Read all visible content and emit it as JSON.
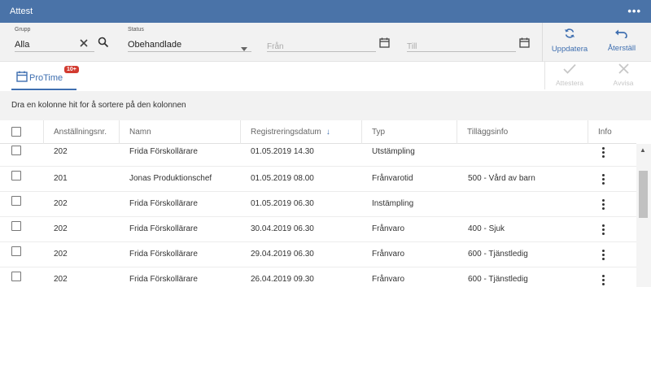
{
  "window": {
    "title": "Attest",
    "more_icon": "more-horizontal-icon"
  },
  "filters": {
    "group": {
      "label": "Grupp",
      "value": "Alla"
    },
    "status": {
      "label": "Status",
      "value": "Obehandlade"
    },
    "from": {
      "placeholder": "Från"
    },
    "to": {
      "placeholder": "Till"
    }
  },
  "actions": {
    "refresh": "Uppdatera",
    "reset": "Återställ",
    "approve": "Attestera",
    "reject": "Avvisa"
  },
  "tabs": [
    {
      "label": "ProTime",
      "badge": "10+"
    }
  ],
  "grid": {
    "group_hint": "Dra en kolonne hit for å sortere på den kolonnen",
    "columns": [
      "Anställningsnr.",
      "Namn",
      "Registreringsdatum",
      "Typ",
      "Tilläggsinfo",
      "Info"
    ],
    "sort_column": "Registreringsdatum",
    "sort_direction": "descending",
    "rows": [
      {
        "emp": "202",
        "name": "Frida Förskollärare",
        "date": "01.05.2019 14.30",
        "type": "Utstämpling",
        "info": ""
      },
      {
        "emp": "201",
        "name": "Jonas Produktionschef",
        "date": "01.05.2019 08.00",
        "type": "Frånvarotid",
        "info": "500 - Vård av barn"
      },
      {
        "emp": "202",
        "name": "Frida Förskollärare",
        "date": "01.05.2019 06.30",
        "type": "Instämpling",
        "info": ""
      },
      {
        "emp": "202",
        "name": "Frida Förskollärare",
        "date": "30.04.2019 06.30",
        "type": "Frånvaro",
        "info": "400 - Sjuk"
      },
      {
        "emp": "202",
        "name": "Frida Förskollärare",
        "date": "29.04.2019 06.30",
        "type": "Frånvaro",
        "info": "600 - Tjänstledig"
      },
      {
        "emp": "202",
        "name": "Frida Förskollärare",
        "date": "26.04.2019 09.30",
        "type": "Frånvaro",
        "info": "600 - Tjänstledig"
      }
    ]
  },
  "colors": {
    "accent": "#3f6fb0",
    "titlebar": "#4a73a8",
    "badge": "#d23b30"
  }
}
